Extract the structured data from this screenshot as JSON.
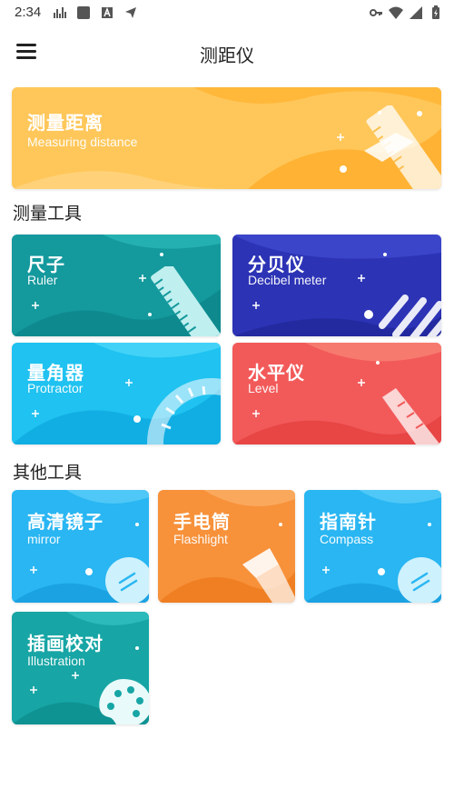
{
  "status_bar": {
    "time": "2:34",
    "left_icons": [
      "activity-icon",
      "square-icon",
      "a-icon",
      "plane-icon"
    ],
    "right_icons": [
      "key-icon",
      "wifi-icon",
      "signal-icon",
      "battery-icon"
    ]
  },
  "app_bar": {
    "title": "测距仪",
    "menu_icon": "menu-icon"
  },
  "hero": {
    "title": "测量距离",
    "subtitle": "Measuring distance",
    "color": "#FBC04F"
  },
  "sections": {
    "measure_tools": "测量工具",
    "other_tools": "其他工具"
  },
  "measure_tools": [
    {
      "title": "尺子",
      "subtitle": "Ruler",
      "color": "#1A9A9E",
      "icon": "ruler-icon"
    },
    {
      "title": "分贝仪",
      "subtitle": "Decibel meter",
      "color": "#2C35B8",
      "icon": "sound-bars-icon"
    },
    {
      "title": "量角器",
      "subtitle": "Protractor",
      "color": "#22C3F0",
      "icon": "protractor-icon"
    },
    {
      "title": "水平仪",
      "subtitle": "Level",
      "color": "#F35E5E",
      "icon": "level-icon"
    }
  ],
  "other_tools": [
    {
      "title": "高清镜子",
      "subtitle": "mirror",
      "color": "#2BB8F2",
      "icon": "mirror-icon"
    },
    {
      "title": "手电筒",
      "subtitle": "Flashlight",
      "color": "#F7923A",
      "icon": "flashlight-icon"
    },
    {
      "title": "指南针",
      "subtitle": "Compass",
      "color": "#2BB8F2",
      "icon": "compass-icon"
    },
    {
      "title": "插画校对",
      "subtitle": "Illustration",
      "color": "#1AA7A7",
      "icon": "palette-icon"
    }
  ]
}
